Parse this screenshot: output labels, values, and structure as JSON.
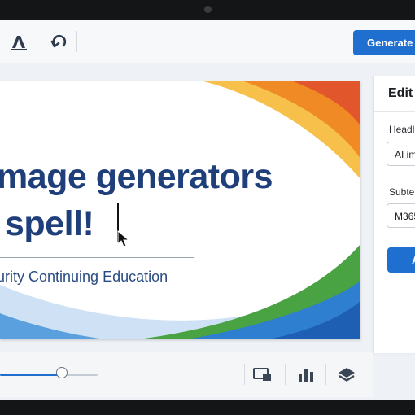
{
  "toolbar": {
    "generate_label": "Generate",
    "icons": [
      "text-style-icon",
      "redo-icon"
    ]
  },
  "canvas": {
    "headline_line1": "mage generators",
    "headline_line2": "spell!",
    "subtext": "urity Continuing Education",
    "colors": {
      "headline": "#1f3f7a",
      "wave_orange": "#f08a24",
      "wave_yellow": "#f6b73c",
      "wave_green": "#4aa343",
      "wave_blue": "#1e5fb3"
    }
  },
  "edit_panel": {
    "title": "Edit",
    "headline_label": "Headli",
    "headline_value": "AI im",
    "subtext_label": "Subte",
    "subtext_value": "M365",
    "apply_label": "A"
  },
  "bottom_bar": {
    "zoom_fraction": 0.63,
    "icons": [
      "screen-share-icon",
      "bar-chart-icon",
      "layers-icon"
    ]
  }
}
